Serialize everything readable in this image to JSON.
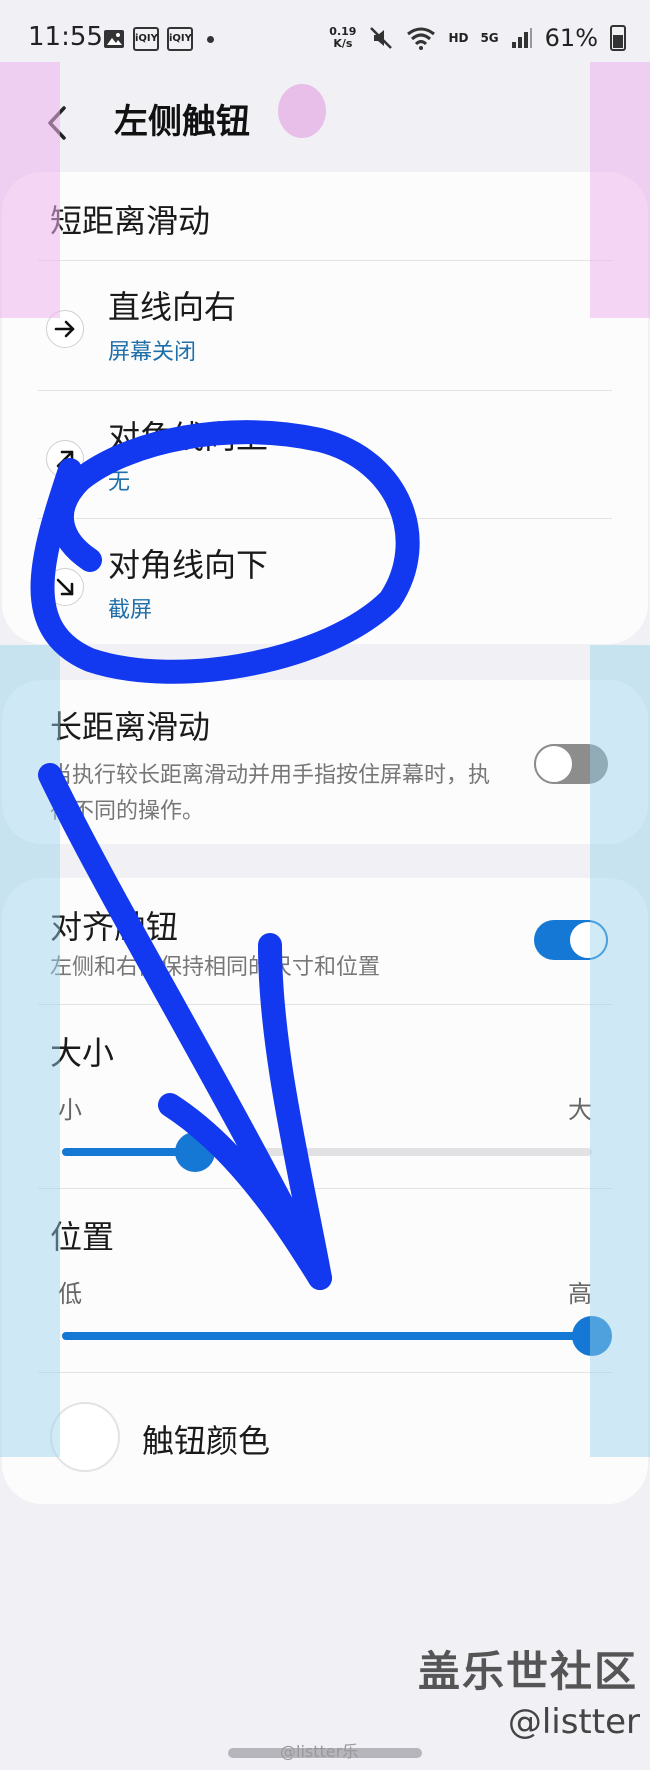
{
  "status_bar": {
    "time": "11:55",
    "notification_icons": [
      "image-icon",
      "iqiyi-icon",
      "iqiyi-icon"
    ],
    "notif_badge_text": "iQIY",
    "network_speed_value": "0.19",
    "network_speed_unit": "K/s",
    "hd_label": "HD",
    "signal_label": "5G",
    "battery": "61%"
  },
  "header": {
    "title": "左侧触钮"
  },
  "short_swipe": {
    "title": "短距离滑动",
    "items": [
      {
        "title": "直线向右",
        "subtitle": "屏幕关闭",
        "icon": "arrow-right-icon"
      },
      {
        "title": "对角线向上",
        "subtitle": "无",
        "icon": "arrow-up-right-icon"
      },
      {
        "title": "对角线向下",
        "subtitle": "截屏",
        "icon": "arrow-down-right-icon"
      }
    ]
  },
  "long_swipe": {
    "title": "长距离滑动",
    "description": "当执行较长距离滑动并用手指按住屏幕时，执行不同的操作。",
    "enabled": false
  },
  "align": {
    "title": "对齐触钮",
    "description": "左侧和右侧保持相同的尺寸和位置",
    "enabled": true
  },
  "size": {
    "title": "大小",
    "min_label": "小",
    "max_label": "大",
    "value": 0.25
  },
  "position": {
    "title": "位置",
    "min_label": "低",
    "max_label": "高",
    "value": 1.0
  },
  "button_color": {
    "title": "触钮颜色"
  },
  "watermark": {
    "site": "盖乐世社区",
    "user": "@listter",
    "weibo": "@listter乐"
  },
  "colors": {
    "accent": "#1478d4",
    "subtitle": "#1f6fa8",
    "annotation_ink": "#1238f0",
    "highlight_pink": "#f0c8f0",
    "highlight_blue": "#bfe4f4"
  }
}
